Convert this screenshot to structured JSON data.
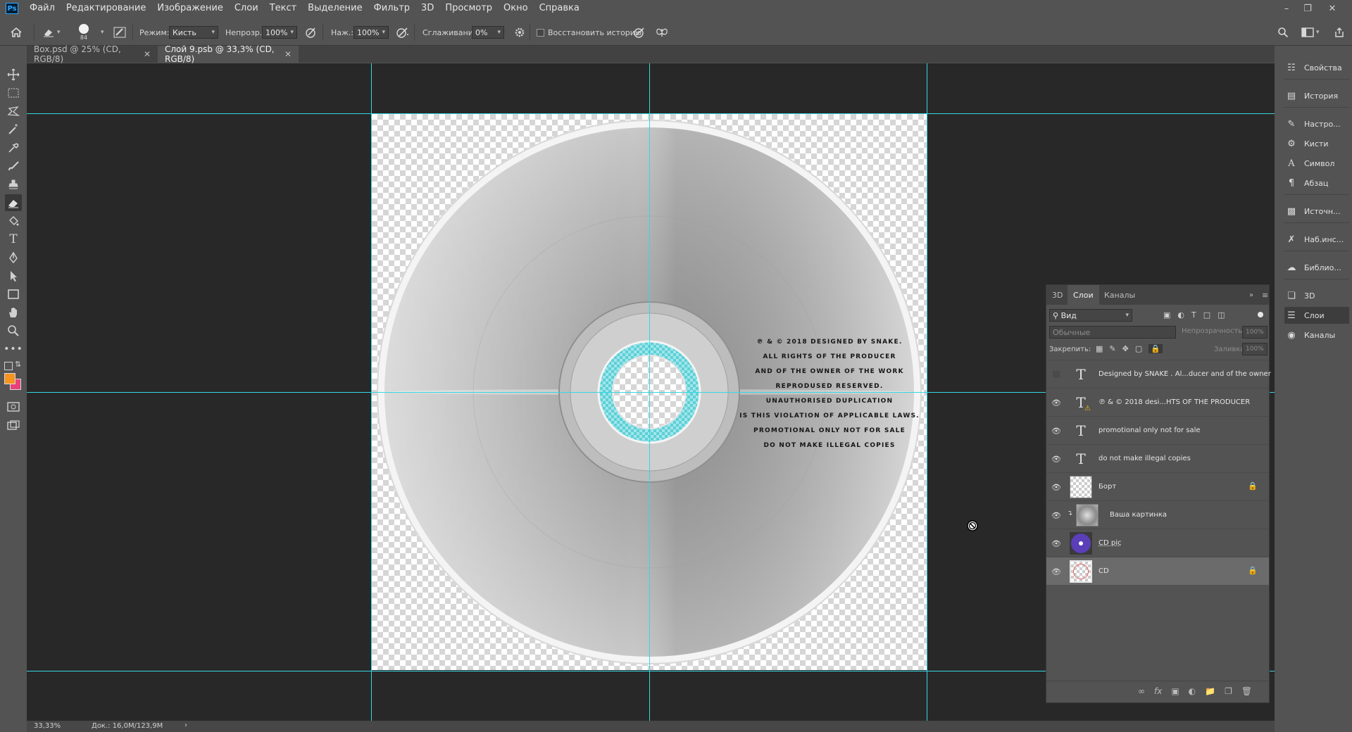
{
  "app": {
    "logo": "Ps"
  },
  "menu": [
    "Файл",
    "Редактирование",
    "Изображение",
    "Слои",
    "Текст",
    "Выделение",
    "Фильтр",
    "3D",
    "Просмотр",
    "Окно",
    "Справка"
  ],
  "window_controls": {
    "minimize_icon": "minimize-icon",
    "restore_icon": "restore-icon",
    "close_icon": "close-icon"
  },
  "options": {
    "brush_size": "84",
    "mode_label": "Режим:",
    "mode_value": "Кисть",
    "opacity_label": "Непрозр.:",
    "opacity_value": "100%",
    "pressure_label": "Наж.:",
    "pressure_value": "100%",
    "smoothing_label": "Сглаживание:",
    "smoothing_value": "0%",
    "restore_history_label": "Восстановить историю",
    "restore_history_checked": false
  },
  "tabs": [
    {
      "label": "Box.psd @ 25% (CD, RGB/8)",
      "active": false
    },
    {
      "label": "Слой 9.psb @ 33,3% (CD, RGB/8)",
      "active": true
    }
  ],
  "canvas_text": [
    "℗ & ©  2018  DESIGNED BY SNAKE.",
    "ALL RIGHTS OF THE PRODUCER",
    "AND OF THE OWNER OF THE WORK",
    "REPRODUSED RESERVED.",
    "UNAUTHORISED DUPLICATION",
    "IS THIS VIOLATION OF APPLICABLE LAWS.",
    "PROMOTIONAL ONLY NOT FOR SALE",
    "DO NOT MAKE ILLEGAL COPIES"
  ],
  "colors": {
    "foreground": "#f7931e",
    "background": "#e8407a",
    "guide": "#38d6e0"
  },
  "layers_panel": {
    "tabs": [
      "3D",
      "Слои",
      "Каналы"
    ],
    "active_tab": "Слои",
    "filter_value": "Вид",
    "blend_mode": "Обычные",
    "opacity_label": "Непрозрачность:",
    "opacity_value": "100%",
    "lock_label": "Закрепить:",
    "fill_label": "Заливка:",
    "fill_value": "100%",
    "layers": [
      {
        "name": "Designed by SNAKE . Al...ducer and of the owner",
        "type": "text",
        "visible": false,
        "locked": false
      },
      {
        "name": "℗ & ©  2018  desi...HTS OF THE PRODUCER",
        "type": "text-warning",
        "visible": true,
        "locked": false
      },
      {
        "name": "promotional only not for sale",
        "type": "text",
        "visible": true,
        "locked": false
      },
      {
        "name": "do not make illegal copies",
        "type": "text",
        "visible": true,
        "locked": false
      },
      {
        "name": "Борт",
        "type": "pixel",
        "visible": true,
        "locked": true
      },
      {
        "name": "Ваша картинка",
        "type": "smart-clipped",
        "visible": true,
        "locked": false
      },
      {
        "name": "CD pic",
        "type": "circle",
        "visible": true,
        "locked": false
      },
      {
        "name": "CD",
        "type": "pixel-selected",
        "visible": true,
        "locked": true,
        "selected": true
      }
    ]
  },
  "dock": [
    {
      "label": "Свойства",
      "icon": "properties-icon"
    },
    {
      "label": "История",
      "icon": "history-icon"
    },
    {
      "label": "Настро...",
      "icon": "adjustments-icon"
    },
    {
      "label": "Кисти",
      "icon": "brushes-icon"
    },
    {
      "label": "Символ",
      "icon": "character-icon"
    },
    {
      "label": "Абзац",
      "icon": "paragraph-icon"
    },
    {
      "label": "Источн...",
      "icon": "clone-source-icon"
    },
    {
      "label": "Наб.инс...",
      "icon": "tool-presets-icon"
    },
    {
      "label": "Библио...",
      "icon": "libraries-icon"
    },
    {
      "label": "3D",
      "icon": "3d-icon"
    },
    {
      "label": "Слои",
      "icon": "layers-icon",
      "active": true
    },
    {
      "label": "Каналы",
      "icon": "channels-icon"
    }
  ],
  "status": {
    "zoom": "33,33%",
    "doc": "Док.: 16,0M/123,9M"
  }
}
